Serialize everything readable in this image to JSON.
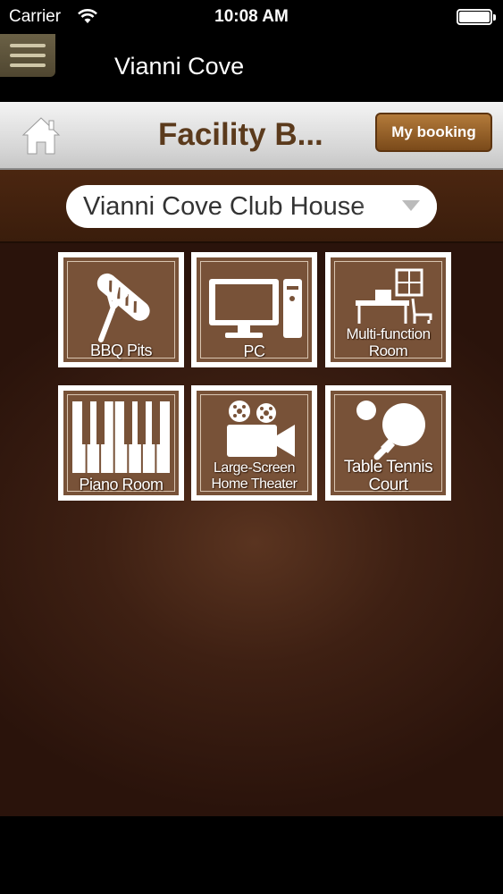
{
  "status_bar": {
    "carrier": "Carrier",
    "time": "10:08 AM"
  },
  "nav": {
    "title": "Vianni Cove"
  },
  "header": {
    "title": "Facility B...",
    "my_booking": "My booking"
  },
  "location": {
    "selected": "Vianni Cove Club House"
  },
  "facilities": [
    {
      "label_lines": [
        "BBQ Pits"
      ],
      "icon": "bbq-icon"
    },
    {
      "label_lines": [
        "PC"
      ],
      "icon": "computer-icon"
    },
    {
      "label_lines": [
        "Multi-function",
        "Room"
      ],
      "icon": "room-icon"
    },
    {
      "label_lines": [
        "Piano Room"
      ],
      "icon": "piano-icon"
    },
    {
      "label_lines": [
        "Large-Screen",
        "Home Theater"
      ],
      "icon": "movie-camera-icon"
    },
    {
      "label_lines": [
        "Table Tennis",
        "Court"
      ],
      "icon": "table-tennis-icon"
    }
  ],
  "colors": {
    "brand_brown": "#5b3a1c",
    "tile_brown": "#785238",
    "button_brown": "#9a6430"
  }
}
